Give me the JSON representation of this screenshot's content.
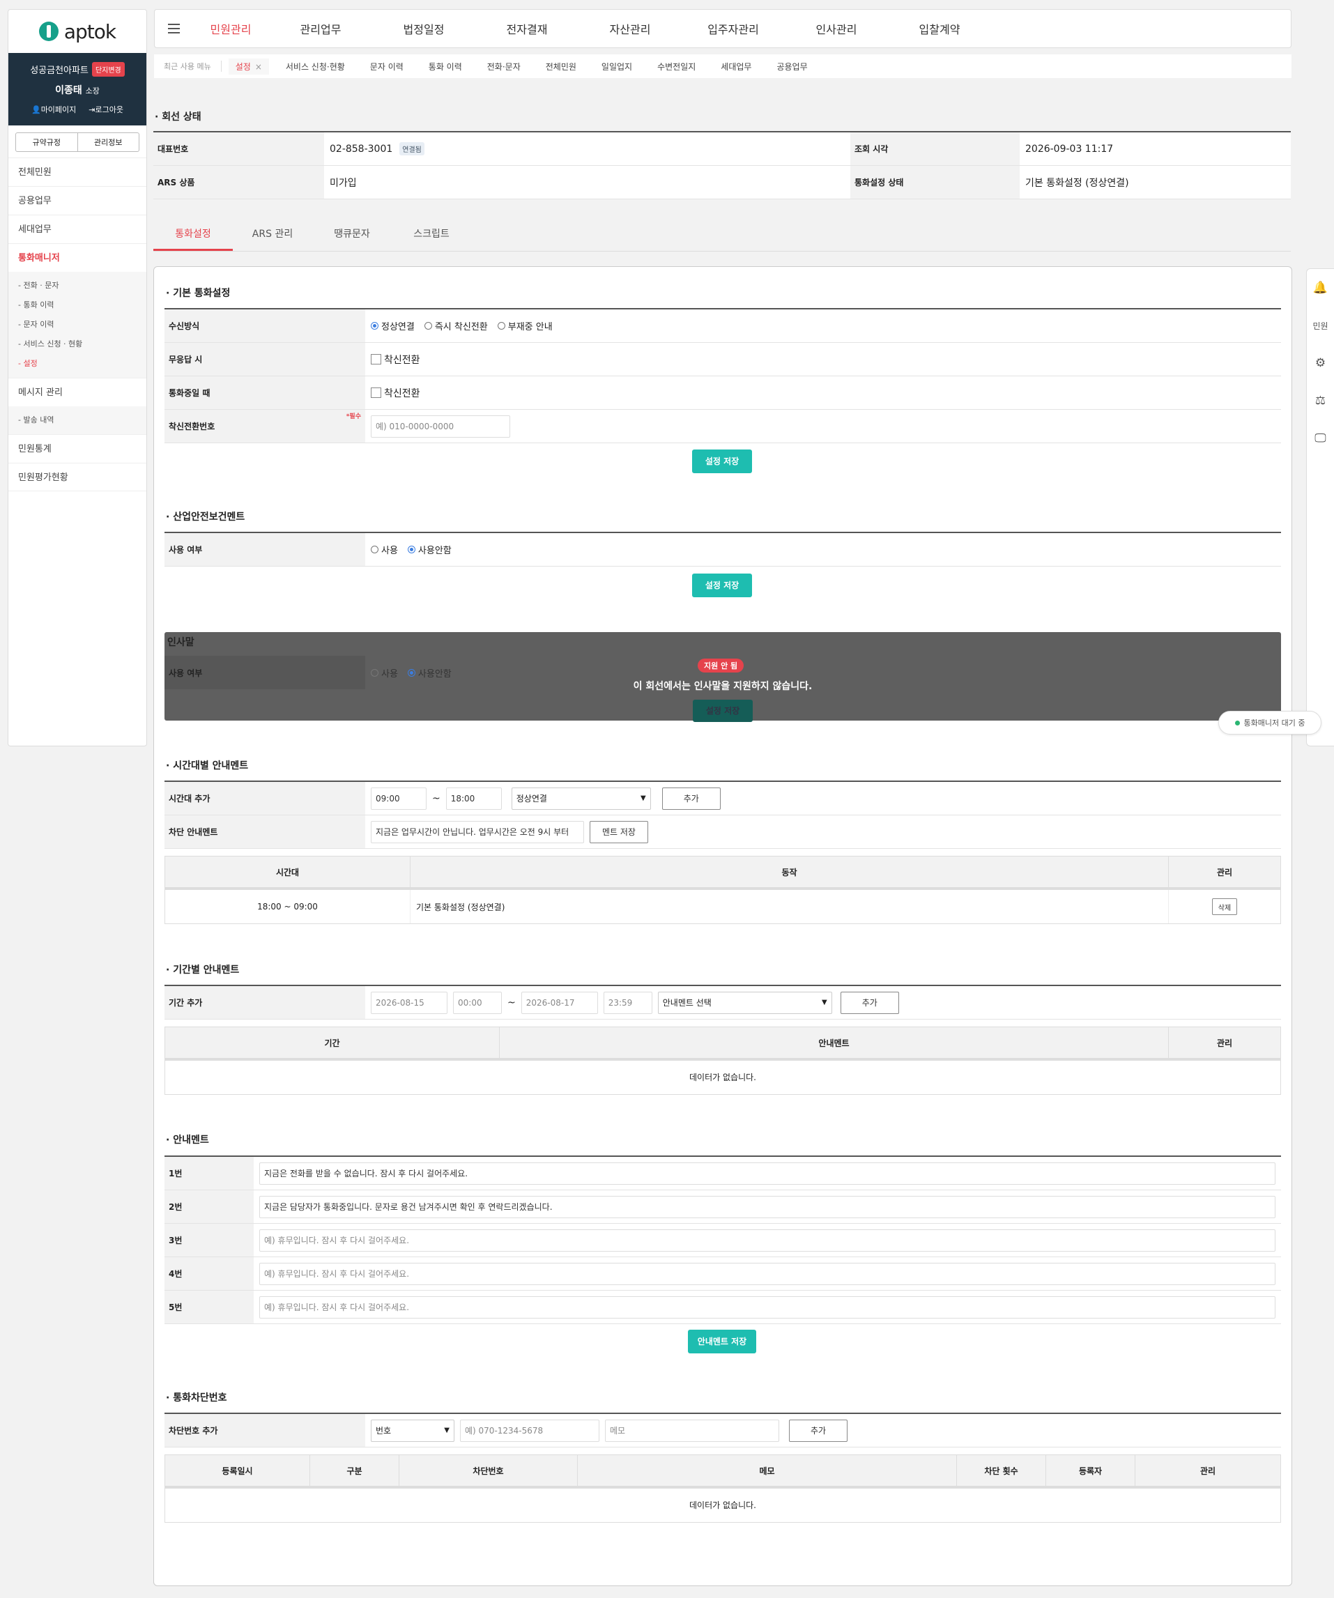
{
  "logo": {
    "text": "aptok"
  },
  "profile": {
    "apartment": "성공금천아파트",
    "change_badge": "단지변경",
    "user_name": "이종태",
    "user_role": "소장",
    "mypage": "마이페이지",
    "logout": "로그아웃"
  },
  "sidebar": {
    "btn_rules": "규약규정",
    "btn_info": "관리정보",
    "items": [
      {
        "label": "전체민원"
      },
      {
        "label": "공용업무"
      },
      {
        "label": "세대업무"
      },
      {
        "label": "통화매니저"
      }
    ],
    "sub_call": [
      "- 전화 · 문자",
      "- 통화 이력",
      "- 문자 이력",
      "- 서비스 신청 · 현황",
      "- 설정"
    ],
    "msg_manage": "메시지 관리",
    "sub_msg": [
      "- 발송 내역"
    ],
    "stats": "민원통계",
    "eval": "민원평가현황"
  },
  "topnav": [
    "민원관리",
    "관리업무",
    "법정일정",
    "전자결재",
    "자산관리",
    "입주자관리",
    "인사관리",
    "입찰계약"
  ],
  "tabbar": {
    "recent": "최근 사용 메뉴",
    "active_tab": "설정",
    "close": "×",
    "links": [
      "서비스 신청·현황",
      "문자 이력",
      "통화 이력",
      "전화·문자",
      "전체민원",
      "일일업지",
      "수변전일지",
      "세대업무",
      "공용업무"
    ]
  },
  "line_status": {
    "title": "회선 상태",
    "rep_label": "대표번호",
    "rep_value": "02-858-3001",
    "rep_chip": "연결됨",
    "time_label": "조회 시각",
    "time_value": "2026-09-03 11:17",
    "ars_label": "ARS 상품",
    "ars_value": "미가입",
    "status_label": "통화설정 상태",
    "status_value": "기본 통화설정 (정상연결)"
  },
  "inner_tabs": [
    "통화설정",
    "ARS 관리",
    "땡큐문자",
    "스크립트"
  ],
  "basic": {
    "title": "기본 통화설정",
    "recv_label": "수신방식",
    "recv_options": [
      "정상연결",
      "즉시 착신전환",
      "부재중 안내"
    ],
    "noanswer_label": "무응답 시",
    "noanswer_opt": "착신전환",
    "busy_label": "통화중일 때",
    "busy_opt": "착신전환",
    "forward_label": "착신전환번호",
    "required": "*필수",
    "forward_placeholder": "예) 010-0000-0000",
    "save": "설정 저장"
  },
  "safety": {
    "title": "산업안전보건멘트",
    "use_label": "사용 여부",
    "opt_use": "사용",
    "opt_nouse": "사용안함",
    "save": "설정 저장"
  },
  "greeting": {
    "title": "인사말",
    "use_label": "사용 여부",
    "opt_use": "사용",
    "opt_nouse": "사용안함",
    "save": "설정 저장",
    "badge": "지원 안 됨",
    "message": "이 회선에서는 인사말을 지원하지 않습니다."
  },
  "time_ment": {
    "title": "시간대별 안내멘트",
    "add_label": "시간대 추가",
    "from": "09:00",
    "tilde": "~",
    "to": "18:00",
    "action": "정상연결",
    "add": "추가",
    "block_label": "차단 안내멘트",
    "block_value": "지금은 업무시간이 안닙니다. 업무시간은 오전 9시 부터",
    "block_save": "멘트 저장",
    "headers": [
      "시간대",
      "동작",
      "관리"
    ],
    "rows": [
      {
        "time": "18:00 ~ 09:00",
        "action": "기본 통화설정 (정상연결)",
        "manage": "삭제"
      }
    ]
  },
  "period_ment": {
    "title": "기간별 안내멘트",
    "add_label": "기간 추가",
    "start_date": "2026-08-15",
    "start_time": "00:00",
    "tilde": "~",
    "end_date": "2026-08-17",
    "end_time": "23:59",
    "select": "안내멘트 선택",
    "add": "추가",
    "headers": [
      "기간",
      "안내멘트",
      "관리"
    ],
    "empty": "데이터가 없습니다."
  },
  "guide_ment": {
    "title": "안내멘트",
    "rows": [
      {
        "label": "1번",
        "value": "지금은 전화를 받을 수 없습니다. 잠시 후 다시 걸어주세요.",
        "placeholder": ""
      },
      {
        "label": "2번",
        "value": "지금은 담당자가 통화중입니다. 문자로 용건 남겨주시면 확인 후 연락드리겠습니다.",
        "placeholder": ""
      },
      {
        "label": "3번",
        "value": "",
        "placeholder": "예) 휴무입니다. 잠시 후 다시 걸어주세요."
      },
      {
        "label": "4번",
        "value": "",
        "placeholder": "예) 휴무입니다. 잠시 후 다시 걸어주세요."
      },
      {
        "label": "5번",
        "value": "",
        "placeholder": "예) 휴무입니다. 잠시 후 다시 걸어주세요."
      }
    ],
    "save": "안내멘트 저장"
  },
  "block_number": {
    "title": "통화차단번호",
    "add_label": "차단번호 추가",
    "type": "번호",
    "number_placeholder": "예) 070-1234-5678",
    "memo_placeholder": "메모",
    "add": "추가",
    "headers": [
      "등록일시",
      "구분",
      "차단번호",
      "메모",
      "차단 횟수",
      "등록자",
      "관리"
    ],
    "empty": "데이터가 없습니다."
  },
  "side_tools": {
    "complaint": "민원"
  },
  "status_pill": "통화매니저 대기 중",
  "colors": {
    "accent": "#e5434c",
    "teal": "#1ebdb0",
    "navy": "#1f3140"
  }
}
